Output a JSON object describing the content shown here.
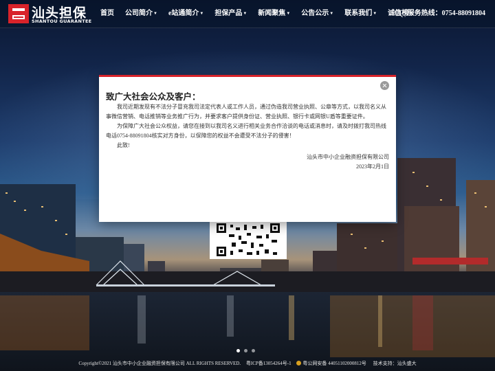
{
  "brand": {
    "name_cn": "汕头担保",
    "name_en": "SHANTOU GUARANTEE"
  },
  "nav": {
    "items": [
      {
        "label": "首页",
        "has_dropdown": false
      },
      {
        "label": "公司简介",
        "has_dropdown": true
      },
      {
        "label": "e站通简介",
        "has_dropdown": true
      },
      {
        "label": "担保产品",
        "has_dropdown": true
      },
      {
        "label": "新闻聚焦",
        "has_dropdown": true
      },
      {
        "label": "公告公示",
        "has_dropdown": true
      },
      {
        "label": "联系我们",
        "has_dropdown": true
      },
      {
        "label": "诚信榜",
        "has_dropdown": true
      }
    ],
    "hotline": "| 服务热线：0754-88091804",
    "caret_glyph": "▼"
  },
  "notice": {
    "title": "致广大社会公众及客户：",
    "paragraphs": [
      "我司近期发现有不法分子冒充我司法定代表人或工作人员，通过伪造我司营业执照、公章等方式，以我司名义从事微信营销、电话推销等业务推广行为，并要求客户提供身份证、营业执照、银行卡或网银U盾等重要证件。",
      "为保障广大社会公众权益，请您在接到以我司名义进行相关业务合作洽谈的电话或消息时，请及时拨打我司热线电话0754-88091804核实对方身份，以保障您的权益不会遭受不法分子的侵害！",
      "此致!"
    ],
    "signature": "汕头市中小企业融资担保有限公司",
    "date": "2023年2月1日"
  },
  "carousel": {
    "slide_count": 3,
    "active_index": 0
  },
  "footer": {
    "copyright": "Copyright©2021 汕头市中小企业融资担保有限公司 ALL RIGHTS RESERVED.",
    "icp": "粤ICP备13054264号-1",
    "police": "粤公网安备 44051102000812号",
    "support": "技术支持：汕头盛大"
  },
  "colors": {
    "accent": "#d8232a",
    "header_bg": "rgba(8,20,40,0.55)"
  }
}
